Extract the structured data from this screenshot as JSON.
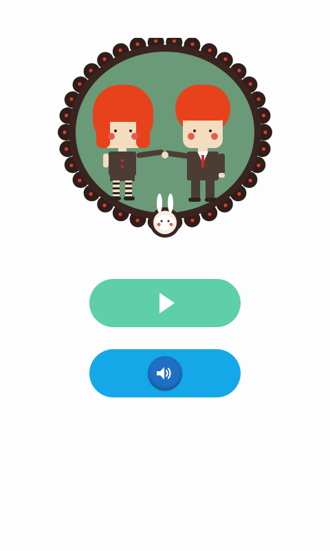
{
  "screen": {
    "background": "#fdfdfd"
  },
  "emblem": {
    "ring_color": "#3a2420",
    "scallop_color": "#2f1e1a",
    "heart_color": "#e23a2c",
    "field_color": "#6a9a78",
    "hair_color": "#e8421c",
    "skin_color": "#f3dcc0",
    "suit_color": "#4b3d33",
    "tie_color": "#d42a1f",
    "stripe_color": "#2b2322",
    "bunny_color": "#ffffff",
    "bunny_badge_ring": "#3a2420",
    "bunny_badge_fill": "#f7efe2",
    "cheek_color": "#e65a4c"
  },
  "buttons": {
    "play": {
      "icon": "play-icon",
      "color": "#5ecfa8",
      "icon_color": "#ffffff"
    },
    "sound": {
      "icon": "speaker-icon",
      "color": "#14a8e8",
      "disc_color": "#1f6fc4",
      "icon_color": "#ffffff"
    }
  }
}
